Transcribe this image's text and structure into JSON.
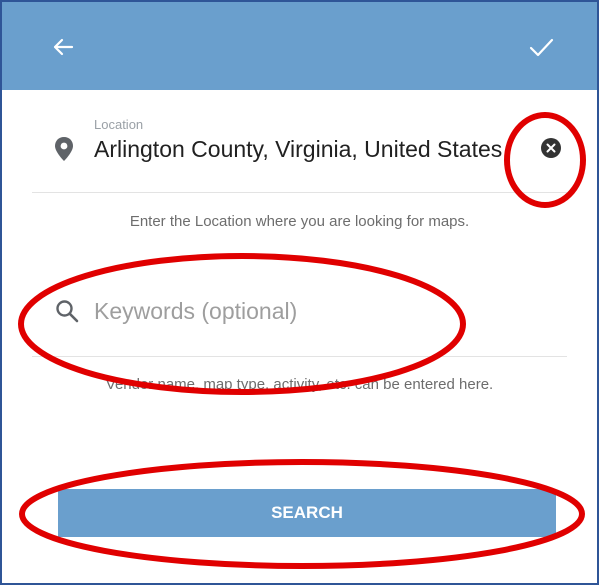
{
  "appbar": {
    "back_icon": "arrow-left-icon",
    "confirm_icon": "check-icon",
    "background": "#6a9fcd"
  },
  "location": {
    "caption": "Location",
    "value": "Arlington County, Virginia, United States",
    "pin_icon": "map-pin-icon",
    "clear_icon": "clear-circle-icon",
    "helper": "Enter the Location where you are looking for maps."
  },
  "keywords": {
    "placeholder": "Keywords (optional)",
    "value": "",
    "search_icon": "magnifier-icon",
    "helper": "Vendor name, map type, activity, etc. can be entered here."
  },
  "search_button": {
    "label": "SEARCH",
    "background": "#6a9fcd"
  },
  "annotations": {
    "color": "#e00000",
    "shape": "ellipse"
  }
}
